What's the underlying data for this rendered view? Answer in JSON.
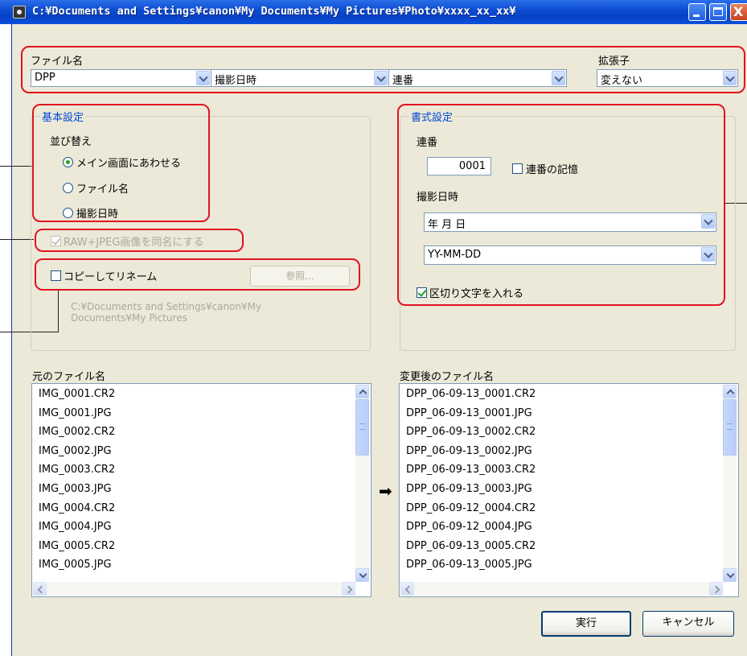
{
  "window": {
    "title": "C:¥Documents and Settings¥canon¥My Documents¥My Pictures¥Photo¥xxxx_xx_xx¥",
    "close_glyph": "X"
  },
  "filename": {
    "label": "ファイル名",
    "field1": "DPP",
    "field2": "撮影日時",
    "field3": "連番",
    "ext_label": "拡張子",
    "ext_value": "変えない"
  },
  "basic": {
    "title": "基本設定",
    "sort_label": "並び替え",
    "options": [
      "メイン画面にあわせる",
      "ファイル名",
      "撮影日時"
    ],
    "selected": 0,
    "raw_jpeg": "RAW+JPEG画像を同名にする",
    "copy_rename": "コピーしてリネーム",
    "browse": "参照...",
    "path": "C:¥Documents and Settings¥canon¥My Documents¥My Pictures"
  },
  "format": {
    "title": "書式設定",
    "seq_label": "連番",
    "seq_value": "0001",
    "seq_memory": "連番の記憶",
    "date_label": "撮影日時",
    "date_order": "年 月 日",
    "date_format": "YY-MM-DD",
    "separator": "区切り文字を入れる"
  },
  "original": {
    "label": "元のファイル名",
    "files": [
      "IMG_0001.CR2",
      "IMG_0001.JPG",
      "IMG_0002.CR2",
      "IMG_0002.JPG",
      "IMG_0003.CR2",
      "IMG_0003.JPG",
      "IMG_0004.CR2",
      "IMG_0004.JPG",
      "IMG_0005.CR2",
      "IMG_0005.JPG"
    ]
  },
  "renamed": {
    "label": "変更後のファイル名",
    "files": [
      "DPP_06-09-13_0001.CR2",
      "DPP_06-09-13_0001.JPG",
      "DPP_06-09-13_0002.CR2",
      "DPP_06-09-13_0002.JPG",
      "DPP_06-09-13_0003.CR2",
      "DPP_06-09-13_0003.JPG",
      "DPP_06-09-12_0004.CR2",
      "DPP_06-09-12_0004.JPG",
      "DPP_06-09-13_0005.CR2",
      "DPP_06-09-13_0005.JPG"
    ]
  },
  "arrow_glyph": "➡",
  "buttons": {
    "run": "実行",
    "cancel": "キャンセル"
  }
}
